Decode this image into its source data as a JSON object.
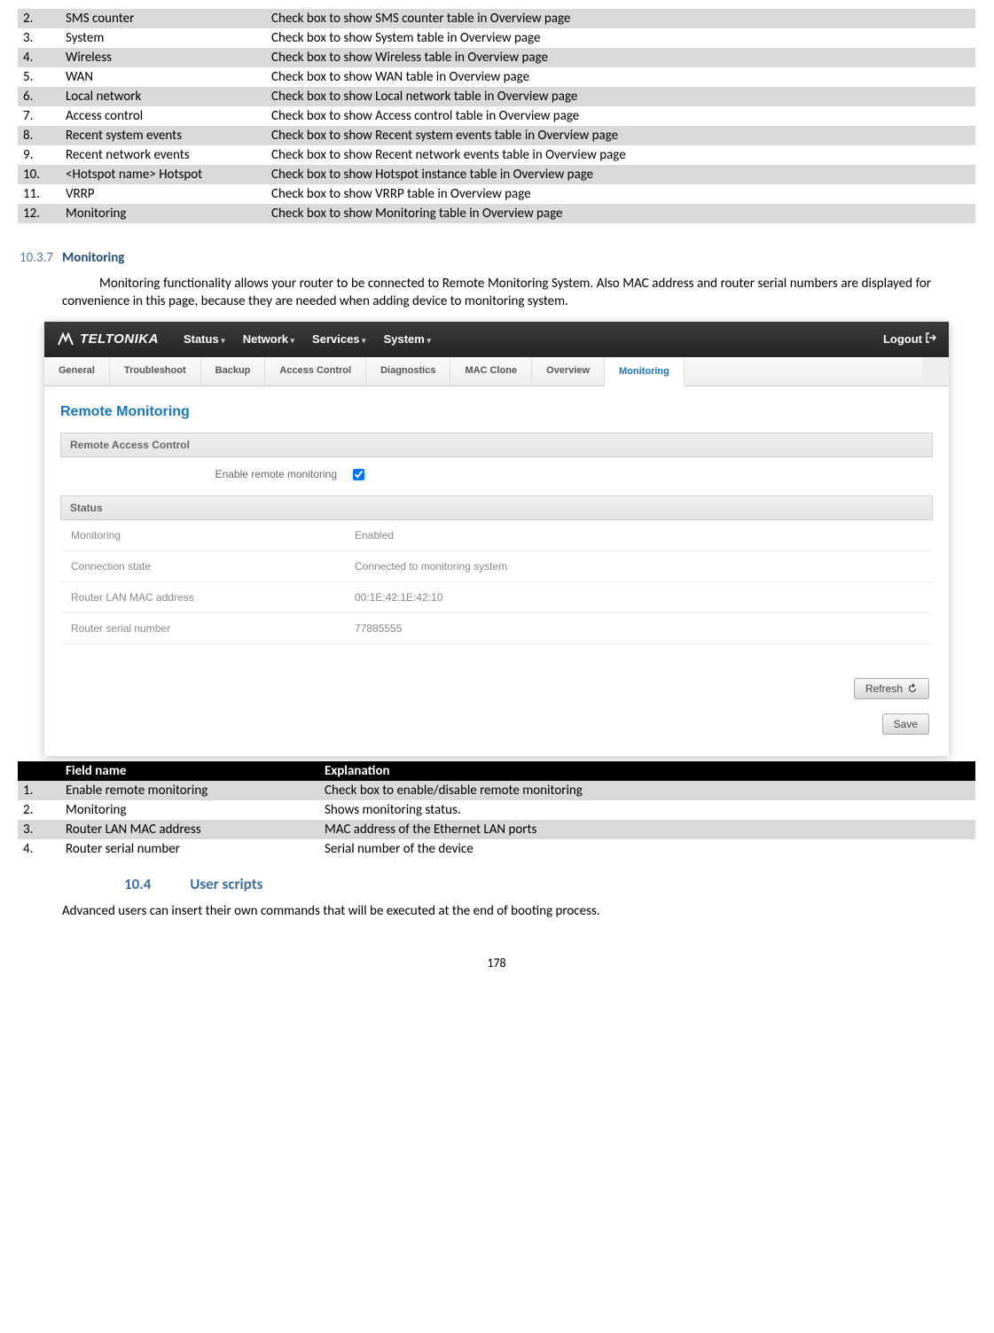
{
  "table1": {
    "rows": [
      {
        "n": "2.",
        "name": "SMS counter",
        "desc": "Check box to show SMS counter table in Overview page"
      },
      {
        "n": "3.",
        "name": "System",
        "desc": "Check box to show System table in Overview page"
      },
      {
        "n": "4.",
        "name": "Wireless",
        "desc": "Check box to show Wireless table in Overview page"
      },
      {
        "n": "5.",
        "name": "WAN",
        "desc": "Check box to show WAN table in Overview page"
      },
      {
        "n": "6.",
        "name": "Local network",
        "desc": "Check box to show Local network table in Overview page"
      },
      {
        "n": "7.",
        "name": "Access control",
        "desc": "Check box to show Access control table in Overview page"
      },
      {
        "n": "8.",
        "name": "Recent system events",
        "desc": "Check box to show Recent system events table in Overview page"
      },
      {
        "n": "9.",
        "name": "Recent network events",
        "desc": "Check box to show Recent network events table in Overview page"
      },
      {
        "n": "10.",
        "name": "<Hotspot name> Hotspot",
        "desc": "Check box to show Hotspot instance table in Overview page"
      },
      {
        "n": "11.",
        "name": "VRRP",
        "desc": "Check box to show VRRP table in Overview page"
      },
      {
        "n": "12.",
        "name": "Monitoring",
        "desc": "Check box to show Monitoring table in Overview page"
      }
    ]
  },
  "section_1037": {
    "num": "10.3.7",
    "title": "Monitoring"
  },
  "para1": "Monitoring functionality allows your router to be connected to Remote Monitoring System. Also MAC address and router serial numbers are displayed for convenience in this page, because they are needed when adding device to monitoring system.",
  "screenshot": {
    "logo_text": "TELTONIKA",
    "topnav": [
      "Status",
      "Network",
      "Services",
      "System"
    ],
    "logout": "Logout",
    "subnav": [
      "General",
      "Troubleshoot",
      "Backup",
      "Access Control",
      "Diagnostics",
      "MAC Clone",
      "Overview",
      "Monitoring"
    ],
    "panel_title": "Remote Monitoring",
    "section1": "Remote Access Control",
    "enable_label": "Enable remote monitoring",
    "section2": "Status",
    "status_rows": [
      {
        "label": "Monitoring",
        "value": "Enabled"
      },
      {
        "label": "Connection state",
        "value": "Connected to monitoring system"
      },
      {
        "label": "Router LAN MAC address",
        "value": "00:1E:42:1E:42:10"
      },
      {
        "label": "Router serial number",
        "value": "77885555"
      }
    ],
    "refresh_btn": "Refresh",
    "save_btn": "Save"
  },
  "table2": {
    "hdr_field": "Field name",
    "hdr_exp": "Explanation",
    "rows": [
      {
        "n": "1.",
        "name": "Enable remote monitoring",
        "desc": "Check box to enable/disable remote monitoring"
      },
      {
        "n": "2.",
        "name": "Monitoring",
        "desc": "Shows monitoring status."
      },
      {
        "n": "3.",
        "name": "Router LAN MAC address",
        "desc": "MAC address of the Ethernet LAN ports"
      },
      {
        "n": "4.",
        "name": "Router serial number",
        "desc": "Serial number of the device"
      }
    ]
  },
  "section_104": {
    "num": "10.4",
    "title": "User scripts"
  },
  "para2": "Advanced users can insert their own commands that will be executed at the end of booting process.",
  "page_num": "178"
}
